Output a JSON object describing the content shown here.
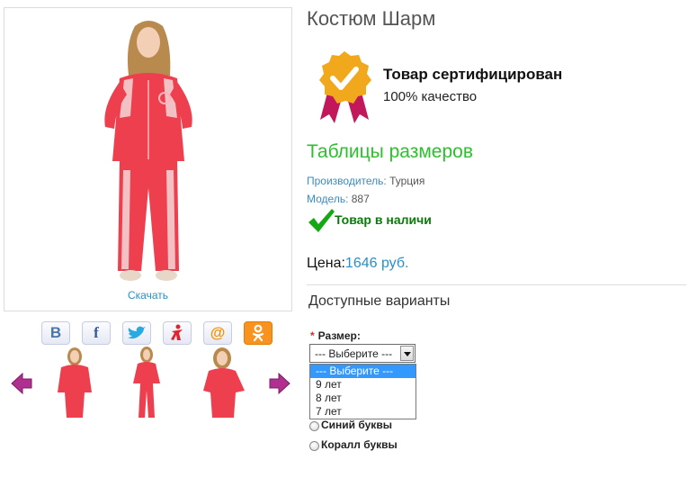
{
  "product": {
    "title": "Костюм Шарм",
    "download_label": "Скачать",
    "certificate": {
      "title": "Товар сертифицирован",
      "subtitle": "100% качество"
    },
    "size_table_link": "Таблицы размеров",
    "manufacturer": {
      "label": "Производитель:",
      "value": "Турция"
    },
    "model": {
      "label": "Модель:",
      "value": "887"
    },
    "stock_status": "Товар в наличи",
    "price": {
      "label": "Цена:",
      "value": "1646 руб."
    }
  },
  "share": {
    "buttons": [
      {
        "icon": "vk-icon",
        "glyph": "B",
        "color": "#4a76a8"
      },
      {
        "icon": "facebook-icon",
        "glyph": "f",
        "color": "#3b5998"
      },
      {
        "icon": "twitter-icon",
        "glyph": "",
        "color": "#29a9e1"
      },
      {
        "icon": "moimir-icon",
        "glyph": "",
        "color": "#e0242b"
      },
      {
        "icon": "mail-icon",
        "glyph": "@",
        "color": "#f39200"
      },
      {
        "icon": "odnoklassniki-icon",
        "glyph": "",
        "color": "#ffffff"
      }
    ]
  },
  "gallery": {
    "thumbnails": [
      "thumb-1",
      "thumb-2",
      "thumb-3"
    ],
    "prev_icon": "arrow-left-icon",
    "next_icon": "arrow-right-icon"
  },
  "options": {
    "heading": "Доступные варианты",
    "size": {
      "label": "Размер:",
      "required_mark": "*",
      "selected": "--- Выберите ---",
      "options": [
        "--- Выберите ---",
        "9 лет",
        "8 лет",
        "7 лет"
      ]
    },
    "radios": [
      "Синий буквы",
      "Коралл буквы"
    ]
  },
  "colors": {
    "accent_green": "#2dbf2d",
    "link_blue": "#2a8fc7",
    "suit_coral": "#ee3f4f",
    "badge_gold": "#f2a81d",
    "ribbon_crimson": "#c2185b",
    "arrow_purple": "#b0308f"
  }
}
